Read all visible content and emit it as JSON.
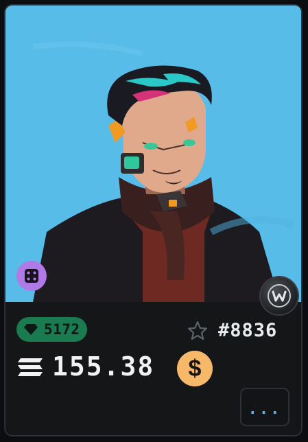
{
  "nft_card": {
    "rank": "5172",
    "token_id": "#8836",
    "price": "155.38",
    "currency_toggle_label": "$",
    "more_label": "...",
    "icons": {
      "rank": "gem-icon",
      "favorite": "star-icon",
      "price_currency": "solana-icon",
      "randomize": "dice-icon",
      "marketplace": "w-logo-icon"
    },
    "colors": {
      "art_background": "#58bce8",
      "rank_badge": "#1a7a50",
      "usd_button": "#f6b96a",
      "dice_button": "#b07ae6",
      "more_dots": "#5ab4e8"
    }
  }
}
